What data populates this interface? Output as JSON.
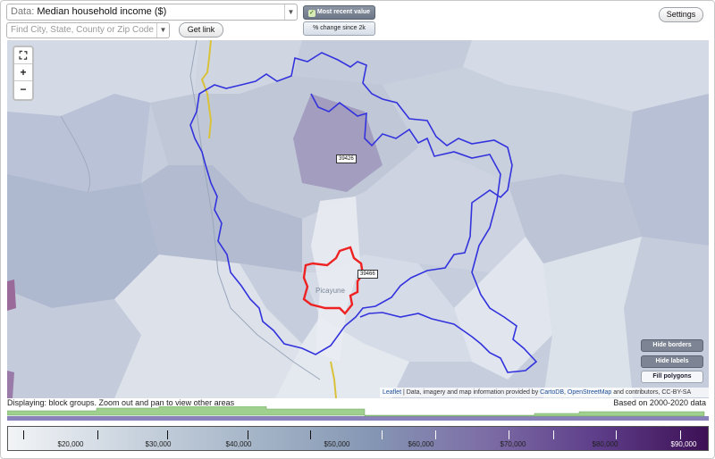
{
  "toolbar": {
    "data_label": "Data:",
    "data_value": "Median household income ($)",
    "find_placeholder": "Find City, State, County or Zip Code",
    "get_link": "Get link",
    "most_recent": "Most recent value",
    "change_since": "% change since 2k",
    "settings": "Settings"
  },
  "map": {
    "zoom_in": "+",
    "zoom_out": "−",
    "zip_labels": [
      "39426",
      "39466"
    ],
    "city_label": "Picayune",
    "buttons": {
      "hide_borders": "Hide borders",
      "hide_labels": "Hide labels",
      "fill_polygons": "Fill polygons"
    },
    "attribution": {
      "leaflet": "Leaflet",
      "mid": " | Data, imagery and map information provided by ",
      "cartodb": "CartoDB",
      "comma": ", ",
      "osm": "OpenStreetMap",
      "end": " and contributors, CC-BY-SA"
    },
    "colors": {
      "selected_zip": "#3333dd",
      "city": "#ee2222",
      "road": "#d9c23a"
    }
  },
  "status": {
    "displaying": "Displaying: block groups. Zoom out and pan to view other areas",
    "based_on": "Based on 2000-2020 data"
  },
  "legend": {
    "labels": [
      "$20,000",
      "$30,000",
      "$40,000",
      "$50,000",
      "$60,000",
      "$70,000",
      "$80,000",
      "$90,000"
    ]
  }
}
